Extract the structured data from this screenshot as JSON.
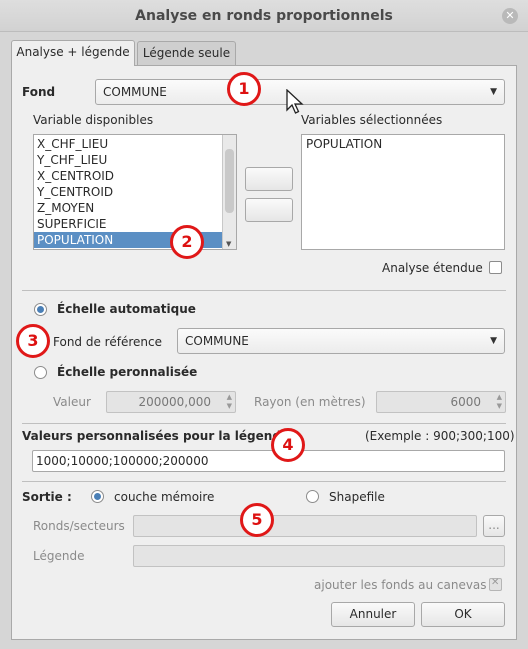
{
  "window": {
    "title": "Analyse en ronds proportionnels",
    "close_glyph": "✕"
  },
  "tabs": [
    {
      "label": "Analyse + légende",
      "active": true
    },
    {
      "label": "Légende seule",
      "active": false
    }
  ],
  "fond": {
    "label": "Fond",
    "value": "COMMUNE"
  },
  "variables": {
    "available_label": "Variable disponibles",
    "available": [
      "X_CHF_LIEU",
      "Y_CHF_LIEU",
      "X_CENTROID",
      "Y_CENTROID",
      "Z_MOYEN",
      "SUPERFICIE",
      "POPULATION"
    ],
    "selected_available": "POPULATION",
    "selected_label": "Variables sélectionnées",
    "selected": [
      "POPULATION"
    ]
  },
  "analyse_etendue": {
    "label": "Analyse étendue",
    "checked": false
  },
  "echelle": {
    "auto_label": "Échelle automatique",
    "auto_selected": true,
    "fond_ref_label": "Fond de référence",
    "fond_ref_value": "COMMUNE",
    "perso_label": "Échelle peronnalisée",
    "valeur_label": "Valeur",
    "valeur_value": "200000,000",
    "rayon_label": "Rayon (en mètres)",
    "rayon_value": "6000"
  },
  "legende_values": {
    "label": "Valeurs personnalisées pour la légende",
    "example": "(Exemple : 900;300;100)",
    "value": "1000;10000;100000;200000"
  },
  "sortie": {
    "label": "Sortie :",
    "memory_label": "couche mémoire",
    "memory_selected": true,
    "shapefile_label": "Shapefile",
    "ronds_label": "Ronds/secteurs",
    "browse_label": "...",
    "legende_label": "Légende",
    "canvas_label": "ajouter les fonds au canevas"
  },
  "buttons": {
    "cancel": "Annuler",
    "ok": "OK"
  },
  "callouts": [
    "1",
    "2",
    "3",
    "4",
    "5"
  ],
  "colors": {
    "callout_border": "#e01818",
    "selection": "#5b8fc4",
    "radio_dot": "#4a7fb6"
  },
  "icons": {
    "mouse_cursor": "cursor-arrow-icon"
  }
}
